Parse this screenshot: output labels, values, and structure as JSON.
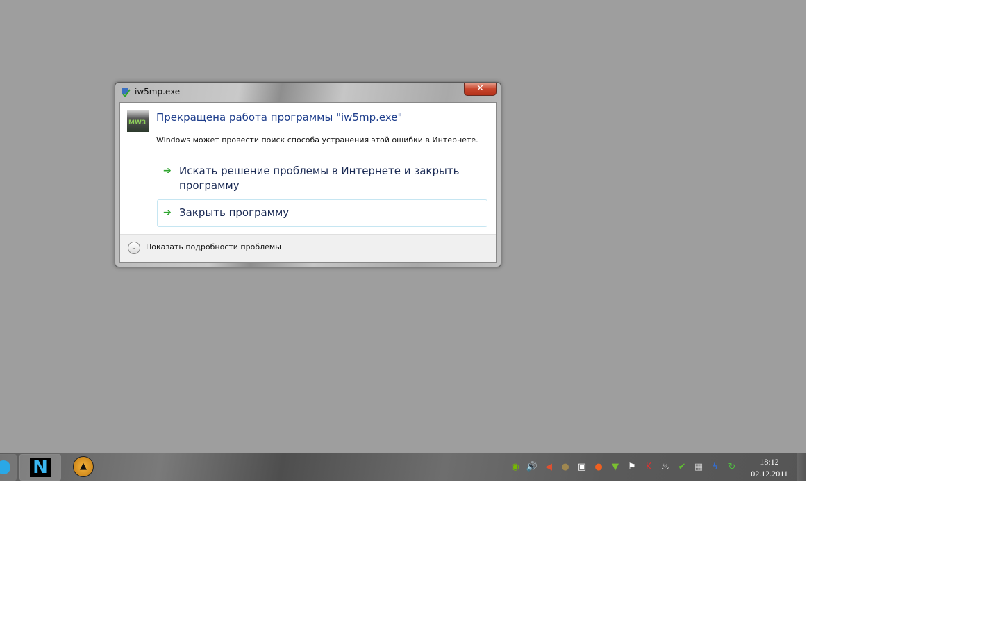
{
  "dialog": {
    "window_title": "iw5mp.exe",
    "close_label": "✕",
    "app_icon_text": "MW3",
    "main_title": "Прекращена работа программы \"iw5mp.exe\"",
    "description": "Windows может провести поиск способа устранения этой ошибки в Интернете.",
    "commands": [
      {
        "label": "Искать решение проблемы в Интернете и закрыть программу",
        "icon": "green-arrow-icon"
      },
      {
        "label": "Закрыть программу",
        "icon": "green-arrow-icon"
      }
    ],
    "details_label": "Показать подробности проблемы"
  },
  "taskbar": {
    "pinned": [
      {
        "name": "skype"
      },
      {
        "name": "N",
        "label": "N"
      },
      {
        "name": "aimp",
        "label": "▲"
      }
    ],
    "tray": [
      {
        "icon": "nvidia-icon",
        "glyph": "◉",
        "color": "#76b900"
      },
      {
        "icon": "volume-icon",
        "glyph": "🔊",
        "color": "#ffffff"
      },
      {
        "icon": "volume-muted-icon",
        "glyph": "◀",
        "color": "#e05030"
      },
      {
        "icon": "app-icon",
        "glyph": "●",
        "color": "#a08850"
      },
      {
        "icon": "network-icon",
        "glyph": "▣",
        "color": "#ffffff"
      },
      {
        "icon": "origin-icon",
        "glyph": "●",
        "color": "#f06020"
      },
      {
        "icon": "download-icon",
        "glyph": "▼",
        "color": "#7ac030"
      },
      {
        "icon": "action-center-flag-icon",
        "glyph": "⚑",
        "color": "#ffffff"
      },
      {
        "icon": "kaspersky-icon",
        "glyph": "K",
        "color": "#e03030"
      },
      {
        "icon": "steam-icon",
        "glyph": "♨",
        "color": "#ffffff"
      },
      {
        "icon": "check-shield-icon",
        "glyph": "✔",
        "color": "#60c030"
      },
      {
        "icon": "utility-icon",
        "glyph": "▦",
        "color": "#cccccc"
      },
      {
        "icon": "lightning-icon",
        "glyph": "ϟ",
        "color": "#3070e0"
      },
      {
        "icon": "update-icon",
        "glyph": "↻",
        "color": "#50c040"
      }
    ],
    "time": "18:12",
    "date": "02.12.2011"
  }
}
